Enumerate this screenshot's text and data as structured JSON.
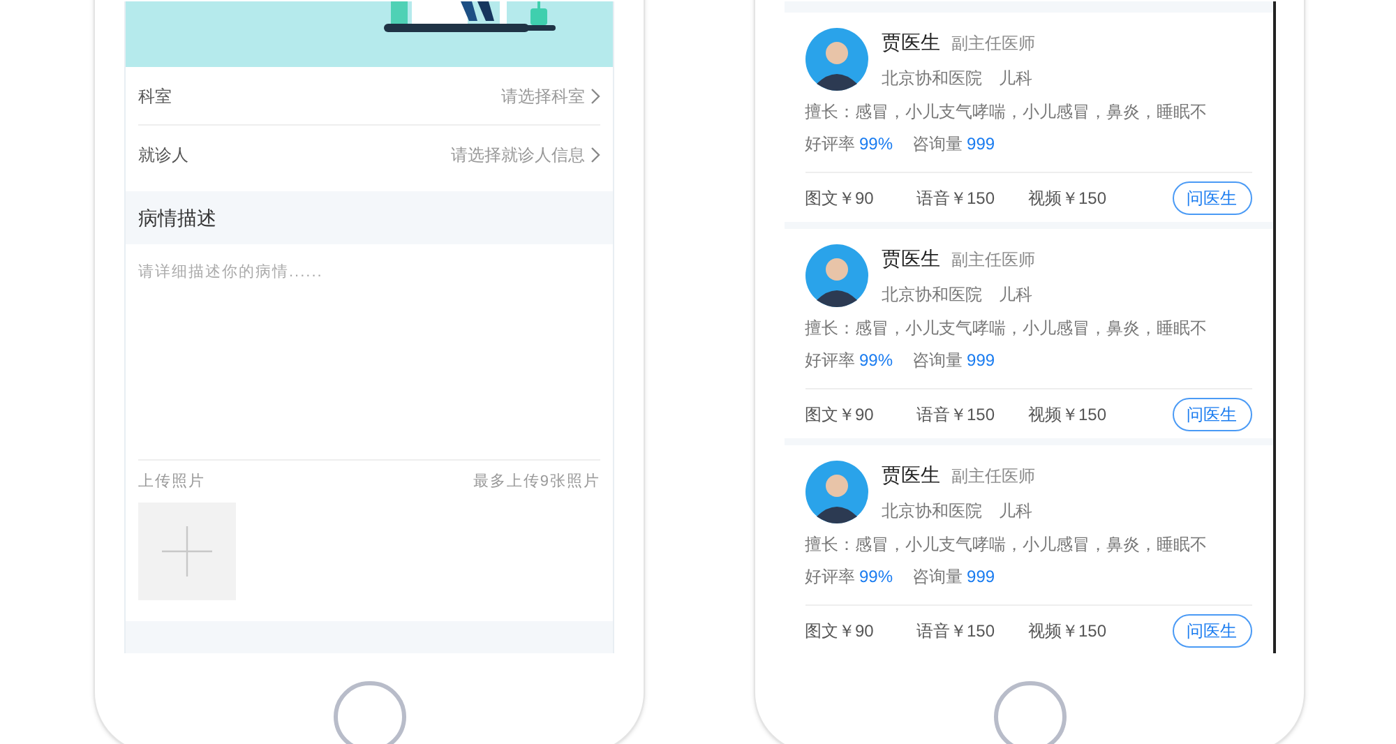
{
  "consult_form": {
    "rows": [
      {
        "label": "科室",
        "placeholder": "请选择科室"
      },
      {
        "label": "就诊人",
        "placeholder": "请选择就诊人信息"
      }
    ],
    "section_title": "病情描述",
    "description": {
      "placeholder": "请详细描述你的病情......"
    },
    "upload": {
      "label": "上传照片",
      "hint": "最多上传9张照片"
    }
  },
  "doctor_list": [
    {
      "name": "贾医生",
      "title": "副主任医师",
      "hospital": "北京协和医院",
      "department": "儿科",
      "specialty": "擅长：感冒，小儿支气哮喘，小儿感冒，鼻炎，睡眠不",
      "rating_label": "好评率",
      "rating": "99%",
      "consults_label": "咨询量",
      "consults": "999",
      "prices": [
        "图文￥90",
        "语音￥150",
        "视频￥150"
      ],
      "button": "问医生"
    },
    {
      "name": "贾医生",
      "title": "副主任医师",
      "hospital": "北京协和医院",
      "department": "儿科",
      "specialty": "擅长：感冒，小儿支气哮喘，小儿感冒，鼻炎，睡眠不",
      "rating_label": "好评率",
      "rating": "99%",
      "consults_label": "咨询量",
      "consults": "999",
      "prices": [
        "图文￥90",
        "语音￥150",
        "视频￥150"
      ],
      "button": "问医生"
    },
    {
      "name": "贾医生",
      "title": "副主任医师",
      "hospital": "北京协和医院",
      "department": "儿科",
      "specialty": "擅长：感冒，小儿支气哮喘，小儿感冒，鼻炎，睡眠不",
      "rating_label": "好评率",
      "rating": "99%",
      "consults_label": "咨询量",
      "consults": "999",
      "prices": [
        "图文￥90",
        "语音￥150",
        "视频￥150"
      ],
      "button": "问医生"
    }
  ]
}
